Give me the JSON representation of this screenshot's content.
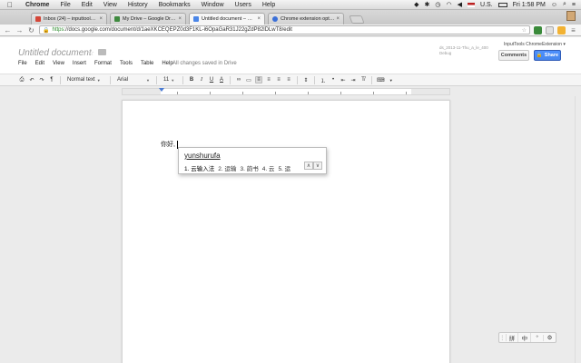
{
  "menubar": {
    "apple": "",
    "items": [
      "Chrome",
      "File",
      "Edit",
      "View",
      "History",
      "Bookmarks",
      "Window",
      "Users",
      "Help"
    ],
    "right": {
      "input_source": "U.S.",
      "clock": "Fri 1:58 PM"
    }
  },
  "tabs": [
    {
      "title": "Inbox (24) – inputtoolsche",
      "favicon_color": "#d44638"
    },
    {
      "title": "My Drive – Google Drive",
      "favicon_color": "#3f8a3f"
    },
    {
      "title": "Untitled document – Goog",
      "favicon_color": "#4a86e8"
    },
    {
      "title": "Chrome extension options",
      "favicon_color": "#3a6fd8"
    }
  ],
  "omnibox": {
    "scheme": "https",
    "url": "://docs.google.com/document/d/1aeXKCEQEPZ0d3F1KL-i6OpaGaR31J22gZdP82lDLwT8/edit"
  },
  "doc": {
    "title": "Untitled document",
    "menus": [
      "File",
      "Edit",
      "View",
      "Insert",
      "Format",
      "Tools",
      "Table",
      "Help"
    ],
    "saved_status": "All changes saved in Drive",
    "account_line1": "ds_2013-11-Thu_a_le_400",
    "account_line2": "Debug",
    "extension_name": "InputTools ChromeExtension",
    "comments_label": "Comments",
    "share_label": "Share"
  },
  "toolbar": {
    "style": "Normal text",
    "font": "Arial",
    "size": "11",
    "bold": "B",
    "italic": "I",
    "underline": "U",
    "textcolor": "A"
  },
  "body": {
    "text": "你好,"
  },
  "ime": {
    "composition_main": "yunshurufa",
    "candidates": [
      "1. 云输入法",
      "2. 运输",
      "3. 韵书",
      "4. 云",
      "5. 运"
    ],
    "prev": "∧",
    "next": "∨"
  },
  "ime_status": {
    "buttons": [
      "拼",
      "中",
      "°",
      "⚙"
    ]
  }
}
